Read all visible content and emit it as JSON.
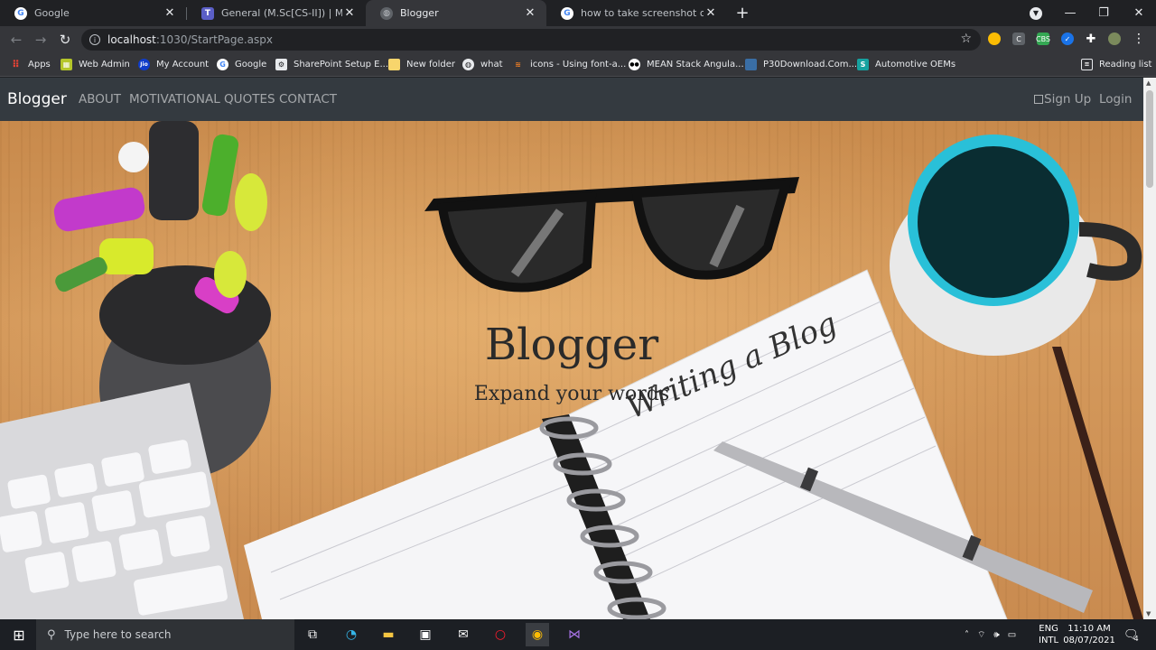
{
  "browser": {
    "tabs": [
      {
        "title": "Google",
        "icon": "google-icon"
      },
      {
        "title": "General (M.Sc[CS-II]) | Microsoft",
        "icon": "teams-icon"
      },
      {
        "title": "Blogger",
        "icon": "globe-icon"
      },
      {
        "title": "how to take screenshot on windo",
        "icon": "google-icon"
      }
    ],
    "new_tab": "+",
    "url_host": "localhost",
    "url_path": ":1030/StartPage.aspx",
    "bookmarks": [
      {
        "label": "Apps",
        "icon": "apps-icon"
      },
      {
        "label": "Web Admin",
        "icon": "webadmin-icon"
      },
      {
        "label": "My Account",
        "icon": "jio-icon"
      },
      {
        "label": "Google",
        "icon": "google-icon"
      },
      {
        "label": "SharePoint Setup E...",
        "icon": "sharepoint-icon"
      },
      {
        "label": "New folder",
        "icon": "folder-icon"
      },
      {
        "label": "what",
        "icon": "globe-icon"
      },
      {
        "label": "icons - Using font-a...",
        "icon": "stack-icon"
      },
      {
        "label": "MEAN Stack Angula...",
        "icon": "mean-icon"
      },
      {
        "label": "P30Download.Com...",
        "icon": "p30-icon"
      },
      {
        "label": "Automotive OEMs",
        "icon": "s-icon"
      }
    ],
    "reading_list": "Reading list"
  },
  "site": {
    "brand": "Blogger",
    "nav": [
      "ABOUT",
      "MOTIVATIONAL QUOTES",
      "CONTACT"
    ],
    "signup": "Sign Up",
    "login": "Login",
    "hero_title": "Blogger",
    "hero_subtitle": "Expand your words",
    "notebook_text": "Writing a Blog"
  },
  "taskbar": {
    "search_placeholder": "Type here to search",
    "lang_top": "ENG",
    "lang_bottom": "INTL",
    "time": "11:10 AM",
    "date": "08/07/2021",
    "notifications": "4"
  }
}
